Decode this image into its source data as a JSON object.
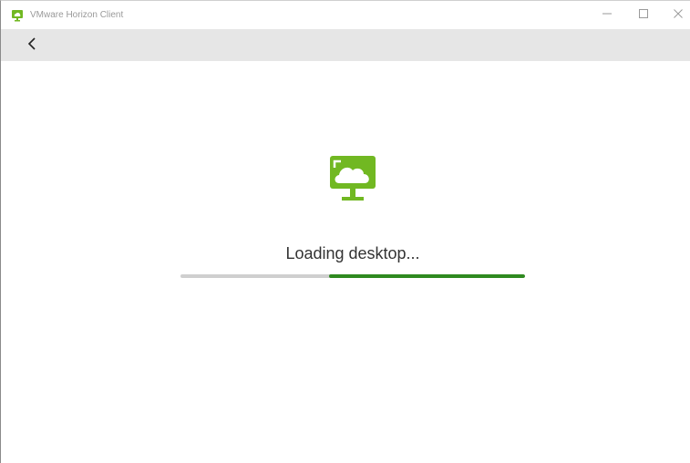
{
  "window": {
    "title": "VMware Horizon Client",
    "controls": {
      "minimize_icon": "minimize-icon",
      "maximize_icon": "maximize-icon",
      "close_icon": "close-icon"
    }
  },
  "navbar": {
    "back_icon": "chevron-left-icon"
  },
  "main": {
    "icon": "desktop-cloud-icon",
    "status_text": "Loading desktop...",
    "progress": {
      "start_fraction": 0.43,
      "end_fraction": 1.0
    }
  },
  "colors": {
    "accent_green": "#71b822",
    "progress_green": "#2f8a1f",
    "progress_track": "#cfcfcf",
    "navbar_bg": "#e6e6e6"
  }
}
